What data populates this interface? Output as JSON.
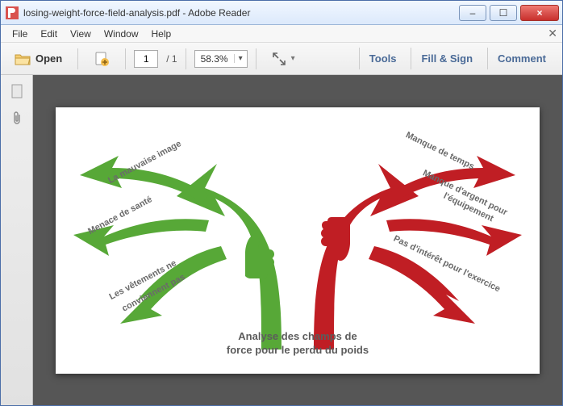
{
  "window": {
    "title": "losing-weight-force-field-analysis.pdf - Adobe Reader",
    "min_label": "–",
    "max_label": "☐",
    "close_label": "×"
  },
  "menu": {
    "file": "File",
    "edit": "Edit",
    "view": "View",
    "window": "Window",
    "help": "Help"
  },
  "toolbar": {
    "open_label": "Open",
    "page_current": "1",
    "page_total": "/ 1",
    "zoom_value": "58.3%",
    "tools_label": "Tools",
    "fill_sign_label": "Fill & Sign",
    "comment_label": "Comment"
  },
  "diagram": {
    "caption_line1": "Analyse des champs de",
    "caption_line2": "force pour le perdu du poids",
    "driving": {
      "f1": "La mauvaise image",
      "f2": "Menace de santé",
      "f3": "Les vêtements ne",
      "f3b": "conviennent pas"
    },
    "restraining": {
      "r1": "Manque de temps",
      "r2": "Manque d'argent pour",
      "r2b": "l'équipement",
      "r3": "Pas d'intérêt pour l'exercice"
    }
  }
}
